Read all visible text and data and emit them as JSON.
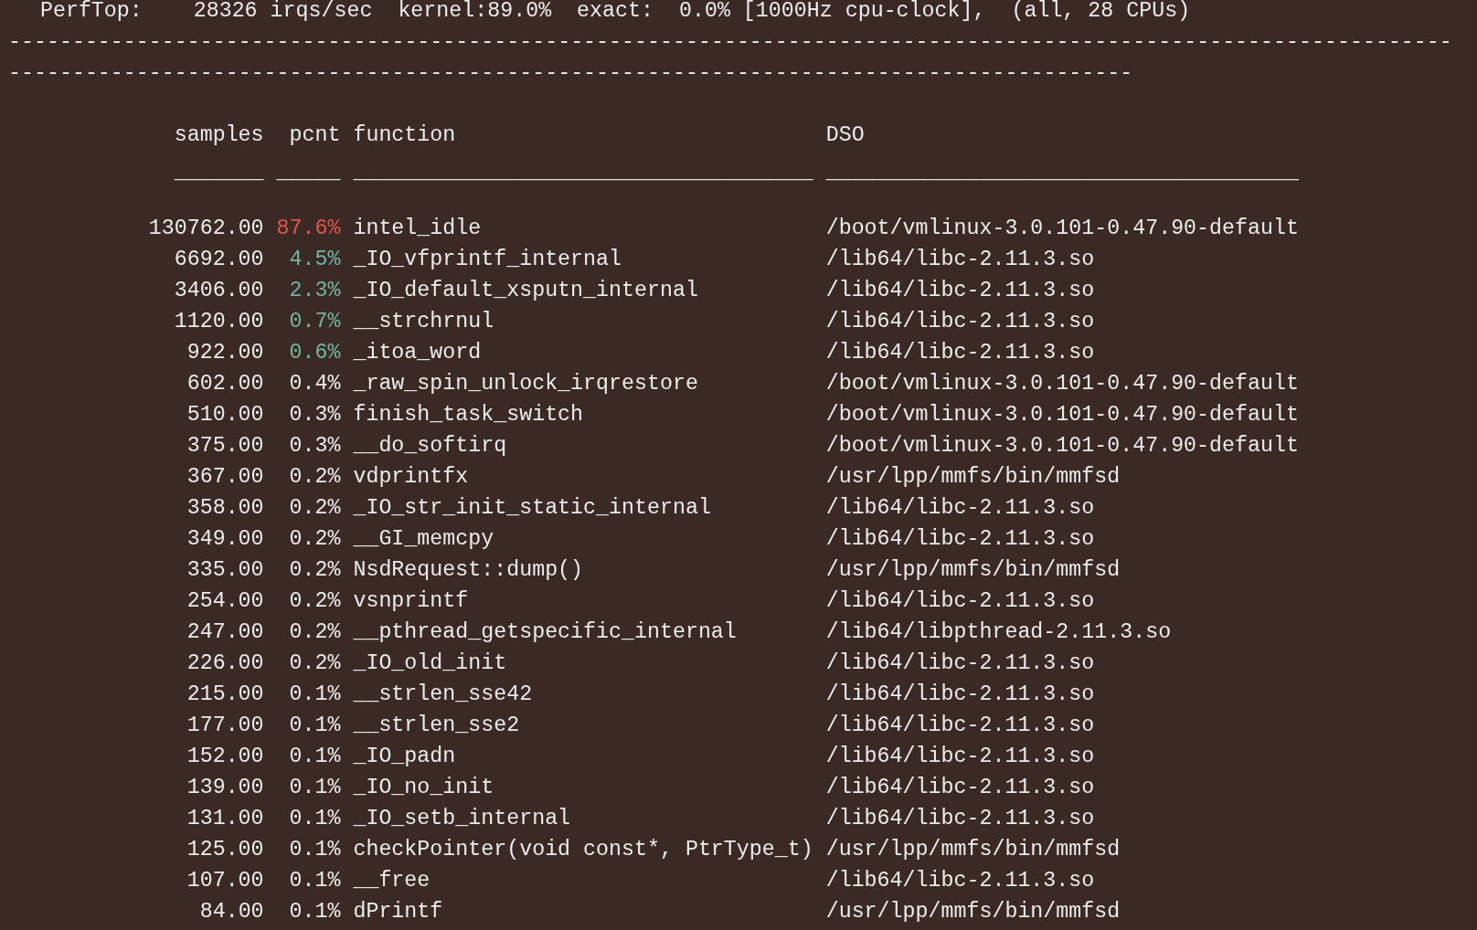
{
  "header": "PerfTop:    28326 irqs/sec  kernel:89.0%  exact:  0.0% [1000Hz cpu-clock],  (all, 28 CPUs)",
  "rules": [
    "-----------------------------------------------------------------------------------------------------------------",
    "----------------------------------------------------------------------------------------"
  ],
  "columns": [
    {
      "label": "samples",
      "underline": "_______"
    },
    {
      "label": "pcnt",
      "underline": "_____"
    },
    {
      "label": "function",
      "underline": "____________________________________"
    },
    {
      "label": "DSO",
      "underline": "_____________________________________"
    }
  ],
  "rows": [
    {
      "samples": "130762.00",
      "pcnt": "87.6%",
      "color": "#e0574b",
      "function": "intel_idle",
      "dso": "/boot/vmlinux-3.0.101-0.47.90-default"
    },
    {
      "samples": "6692.00",
      "pcnt": "4.5%",
      "color": "#72b3a2",
      "function": "_IO_vfprintf_internal",
      "dso": "/lib64/libc-2.11.3.so"
    },
    {
      "samples": "3406.00",
      "pcnt": "2.3%",
      "color": "#72b3a2",
      "function": "_IO_default_xsputn_internal",
      "dso": "/lib64/libc-2.11.3.so"
    },
    {
      "samples": "1120.00",
      "pcnt": "0.7%",
      "color": "#72b3a2",
      "function": "__strchrnul",
      "dso": "/lib64/libc-2.11.3.so"
    },
    {
      "samples": "922.00",
      "pcnt": "0.6%",
      "color": "#72b3a2",
      "function": "_itoa_word",
      "dso": "/lib64/libc-2.11.3.so"
    },
    {
      "samples": "602.00",
      "pcnt": "0.4%",
      "color": "#ececec",
      "function": "_raw_spin_unlock_irqrestore",
      "dso": "/boot/vmlinux-3.0.101-0.47.90-default"
    },
    {
      "samples": "510.00",
      "pcnt": "0.3%",
      "color": "#ececec",
      "function": "finish_task_switch",
      "dso": "/boot/vmlinux-3.0.101-0.47.90-default"
    },
    {
      "samples": "375.00",
      "pcnt": "0.3%",
      "color": "#ececec",
      "function": "__do_softirq",
      "dso": "/boot/vmlinux-3.0.101-0.47.90-default"
    },
    {
      "samples": "367.00",
      "pcnt": "0.2%",
      "color": "#ececec",
      "function": "vdprintfx",
      "dso": "/usr/lpp/mmfs/bin/mmfsd"
    },
    {
      "samples": "358.00",
      "pcnt": "0.2%",
      "color": "#ececec",
      "function": "_IO_str_init_static_internal",
      "dso": "/lib64/libc-2.11.3.so"
    },
    {
      "samples": "349.00",
      "pcnt": "0.2%",
      "color": "#ececec",
      "function": "__GI_memcpy",
      "dso": "/lib64/libc-2.11.3.so"
    },
    {
      "samples": "335.00",
      "pcnt": "0.2%",
      "color": "#ececec",
      "function": "NsdRequest::dump()",
      "dso": "/usr/lpp/mmfs/bin/mmfsd"
    },
    {
      "samples": "254.00",
      "pcnt": "0.2%",
      "color": "#ececec",
      "function": "vsnprintf",
      "dso": "/lib64/libc-2.11.3.so"
    },
    {
      "samples": "247.00",
      "pcnt": "0.2%",
      "color": "#ececec",
      "function": "__pthread_getspecific_internal",
      "dso": "/lib64/libpthread-2.11.3.so"
    },
    {
      "samples": "226.00",
      "pcnt": "0.2%",
      "color": "#ececec",
      "function": "_IO_old_init",
      "dso": "/lib64/libc-2.11.3.so"
    },
    {
      "samples": "215.00",
      "pcnt": "0.1%",
      "color": "#ececec",
      "function": "__strlen_sse42",
      "dso": "/lib64/libc-2.11.3.so"
    },
    {
      "samples": "177.00",
      "pcnt": "0.1%",
      "color": "#ececec",
      "function": "__strlen_sse2",
      "dso": "/lib64/libc-2.11.3.so"
    },
    {
      "samples": "152.00",
      "pcnt": "0.1%",
      "color": "#ececec",
      "function": "_IO_padn",
      "dso": "/lib64/libc-2.11.3.so"
    },
    {
      "samples": "139.00",
      "pcnt": "0.1%",
      "color": "#ececec",
      "function": "_IO_no_init",
      "dso": "/lib64/libc-2.11.3.so"
    },
    {
      "samples": "131.00",
      "pcnt": "0.1%",
      "color": "#ececec",
      "function": "_IO_setb_internal",
      "dso": "/lib64/libc-2.11.3.so"
    },
    {
      "samples": "125.00",
      "pcnt": "0.1%",
      "color": "#ececec",
      "function": "checkPointer(void const*, PtrType_t)",
      "dso": "/usr/lpp/mmfs/bin/mmfsd"
    },
    {
      "samples": "107.00",
      "pcnt": "0.1%",
      "color": "#ececec",
      "function": "__free",
      "dso": "/lib64/libc-2.11.3.so"
    },
    {
      "samples": "84.00",
      "pcnt": "0.1%",
      "color": "#ececec",
      "function": "dPrintf",
      "dso": "/usr/lpp/mmfs/bin/mmfsd"
    }
  ]
}
